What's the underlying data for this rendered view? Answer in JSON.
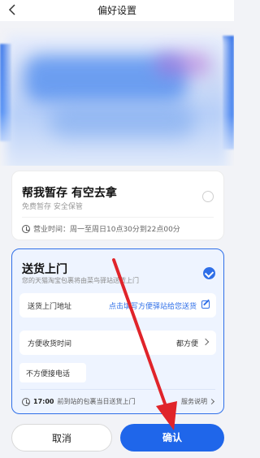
{
  "header": {
    "title": "偏好设置",
    "back_icon": "chevron-left-icon"
  },
  "option_hold": {
    "title": "帮我暂存 有空去拿",
    "subtitle": "免费暂存 安全保管",
    "hours": "营业时间：周一至周日10点30分到22点00分",
    "selected": false
  },
  "option_delivery": {
    "title": "送货上门",
    "subtitle": "您的天猫淘宝包裹将由菜鸟驿站送货上门",
    "selected": true,
    "address_label": "送货上门地址",
    "address_link": "点击填写方便驿站给您送货",
    "time_label": "方便收货时间",
    "time_value": "都方便",
    "phone_toggle": "不方便接电话",
    "footer_time": "17:00",
    "footer_text": "前到站的包裹当日送货上门",
    "service_link": "服务说明"
  },
  "actions": {
    "cancel": "取消",
    "confirm": "确认"
  },
  "colors": {
    "accent": "#1f66ea",
    "annotation": "#e0242a"
  }
}
